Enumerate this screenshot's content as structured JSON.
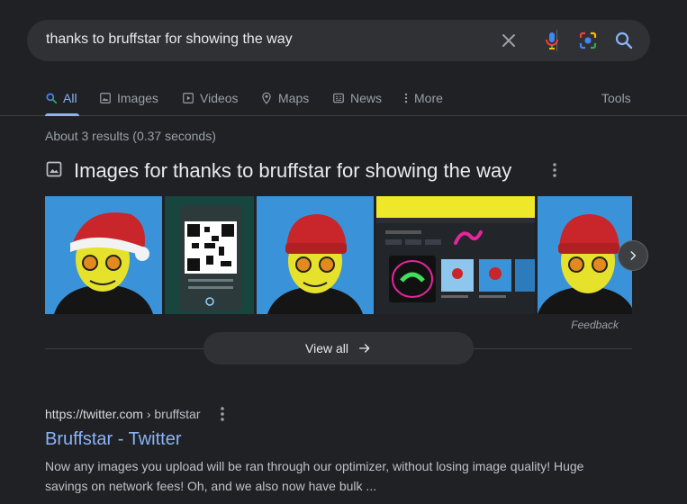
{
  "search": {
    "query": "thanks to bruffstar for showing the way",
    "icons": [
      "clear-icon",
      "mic-icon",
      "lens-icon",
      "search-icon"
    ]
  },
  "tabs": {
    "all": "All",
    "images": "Images",
    "videos": "Videos",
    "maps": "Maps",
    "news": "News",
    "more": "More",
    "tools": "Tools"
  },
  "stats": "About 3 results (0.37 seconds)",
  "images_block": {
    "heading": "Images for thanks to bruffstar for showing the way",
    "thumbnails": [
      "santa-hat-portrait",
      "qr-code-screen",
      "red-beanie-portrait",
      "dashboard-screenshot",
      "red-beanie-portrait-2"
    ],
    "feedback": "Feedback",
    "view_all": "View all"
  },
  "result": {
    "url_domain": "https://twitter.com",
    "url_path": " › bruffstar",
    "title": "Bruffstar - Twitter",
    "snippet": "Now any images you upload will be ran through our optimizer, without losing image quality! Huge savings on network fees! Oh, and we also now have bulk ..."
  },
  "colors": {
    "background": "#202124",
    "accent": "#8ab4f8",
    "searchbar": "#303134",
    "thumb_blue": "#3a93d8"
  }
}
